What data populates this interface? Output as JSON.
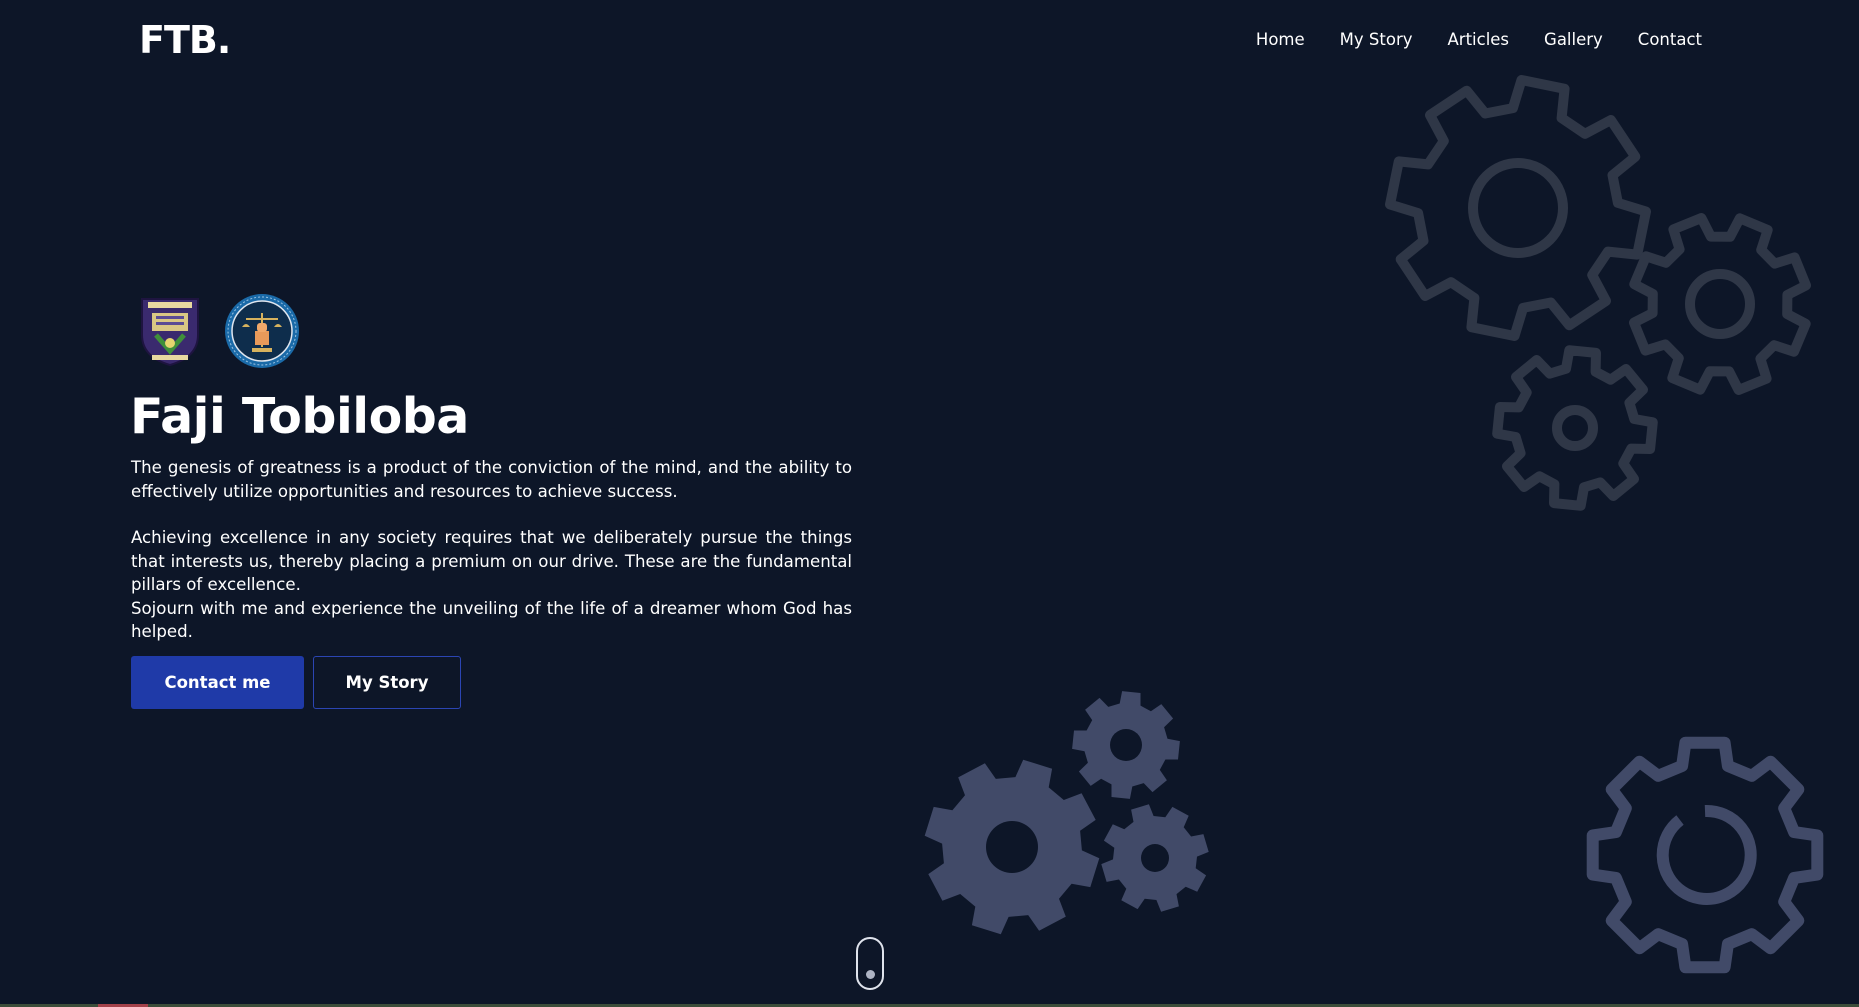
{
  "brand": {
    "logo": "FTB."
  },
  "nav": {
    "items": [
      "Home",
      "My Story",
      "Articles",
      "Gallery",
      "Contact"
    ]
  },
  "hero": {
    "title": "Faji Tobiloba",
    "paragraph1": "The genesis of greatness is a product of the conviction of the mind, and the ability to effectively utilize opportunities and resources to achieve success.",
    "paragraph2": "Achieving excellence in any society requires that we deliberately pursue the things that interests us, thereby placing a premium on our drive. These are the fundamental pillars of excellence.",
    "paragraph3": "Sojourn with me and experience the unveiling of the life of a dreamer whom God has helped.",
    "primary_button": "Contact me",
    "secondary_button": "My Story"
  },
  "colors": {
    "background": "#0d1628",
    "primary_button": "#1f3aa8",
    "gear_outline": "#2f3747",
    "gear_fill": "#414a68"
  },
  "icons": [
    "university-crest-icon",
    "justice-seal-icon",
    "gear-icon",
    "mouse-scroll-icon"
  ]
}
